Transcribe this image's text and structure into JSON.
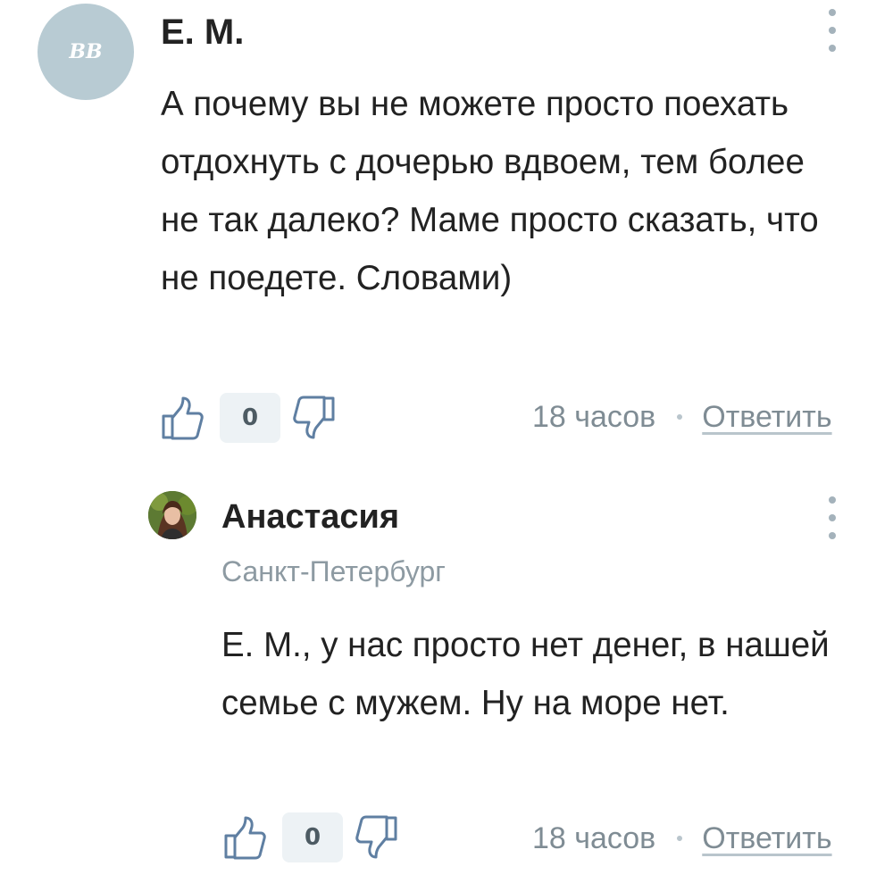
{
  "comments": [
    {
      "avatar_initials": "ВВ",
      "author": "Е. М.",
      "text": "А почему вы не можете просто поехать отдохнуть с дочерью вдвоем, тем более не так далеко? Маме просто сказать, что не поедете. Словами)",
      "score": "0",
      "time": "18 часов",
      "reply_label": "Ответить",
      "icons": {
        "like": "thumbs-up-icon",
        "dislike": "thumbs-down-icon",
        "menu": "more-vertical-icon"
      }
    },
    {
      "author": "Анастасия",
      "location": "Санкт-Петербург",
      "text": "Е. М., у нас просто нет денег, в нашей семье с мужем. Ну на море нет.",
      "score": "0",
      "time": "18 часов",
      "reply_label": "Ответить",
      "icons": {
        "like": "thumbs-up-icon",
        "dislike": "thumbs-down-icon",
        "menu": "more-vertical-icon"
      }
    }
  ],
  "colors": {
    "avatar_bg": "#b8cbd3",
    "icon_stroke": "#5f7fa2",
    "score_bg": "#edf2f5",
    "meta_text": "#7f8c94"
  }
}
